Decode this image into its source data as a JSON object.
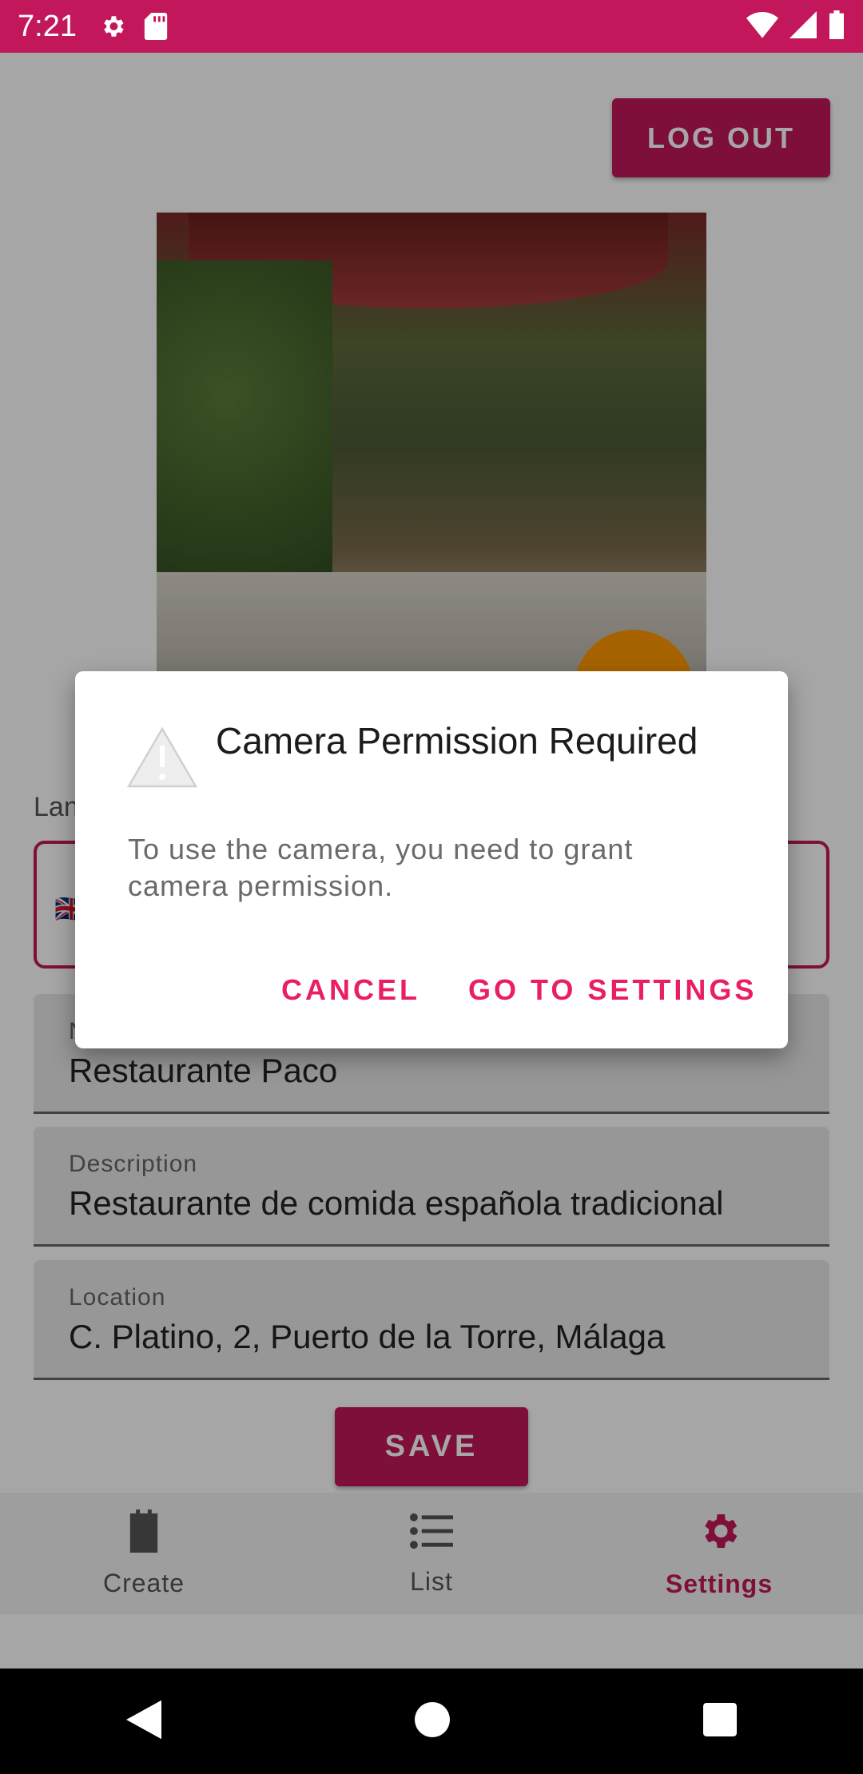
{
  "statusbar": {
    "time": "7:21"
  },
  "app": {
    "logout_label": "LOG OUT",
    "language_label": "Lan",
    "fields": [
      {
        "label": "N",
        "value": "Restaurante Paco"
      },
      {
        "label": "Description",
        "value": "Restaurante de comida española tradicional"
      },
      {
        "label": "Location",
        "value": "C. Platino, 2, Puerto de la Torre, Málaga"
      }
    ],
    "save_label": "SAVE"
  },
  "bottomnav": {
    "items": [
      {
        "label": "Create",
        "icon": "clipboard-icon"
      },
      {
        "label": "List",
        "icon": "list-icon"
      },
      {
        "label": "Settings",
        "icon": "gear-icon"
      }
    ]
  },
  "dialog": {
    "title": "Camera Permission Required",
    "message": "To use the camera, you need to grant camera permission.",
    "cancel_label": "CANCEL",
    "settings_label": "GO TO SETTINGS"
  },
  "colors": {
    "primary": "#c2185b",
    "accent": "#e91e63",
    "fab": "#ff9800"
  }
}
